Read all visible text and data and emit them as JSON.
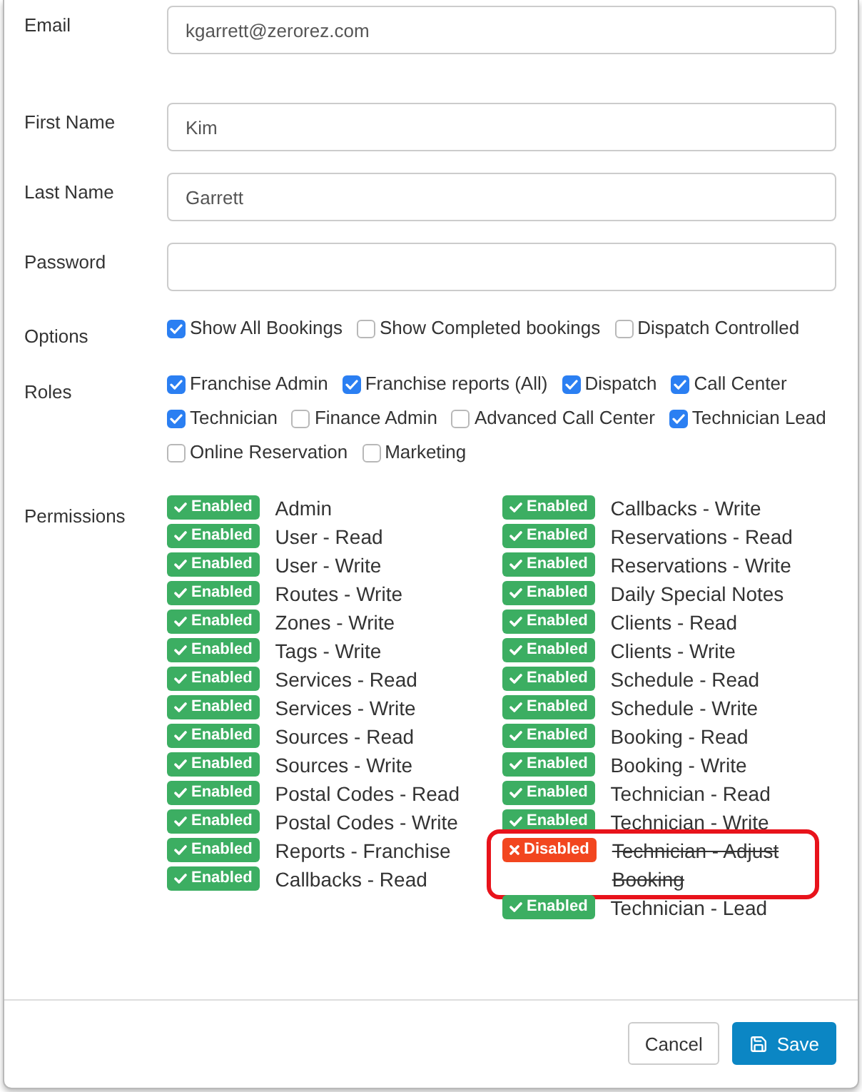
{
  "fields": [
    {
      "label": "Email",
      "value": "kgarrett@zerorez.com"
    },
    {
      "label": "First Name",
      "value": "Kim"
    },
    {
      "label": "Last Name",
      "value": "Garrett"
    },
    {
      "label": "Password"
    }
  ],
  "options": {
    "label": "Options",
    "items": [
      {
        "label": "Show All Bookings",
        "checked": true
      },
      {
        "label": "Show Completed bookings",
        "checked": false
      },
      {
        "label": "Dispatch Controlled",
        "checked": false
      }
    ]
  },
  "roles": {
    "label": "Roles",
    "items": [
      {
        "label": "Franchise Admin",
        "checked": true
      },
      {
        "label": "Franchise reports (All)",
        "checked": true
      },
      {
        "label": "Dispatch",
        "checked": true
      },
      {
        "label": "Call Center",
        "checked": true
      },
      {
        "label": "Technician",
        "checked": true
      },
      {
        "label": "Finance Admin",
        "checked": false
      },
      {
        "label": "Advanced Call Center",
        "checked": false
      },
      {
        "label": "Technician Lead",
        "checked": true
      },
      {
        "label": "Online Reservation",
        "checked": false
      },
      {
        "label": "Marketing",
        "checked": false
      }
    ]
  },
  "permissions": {
    "label": "Permissions",
    "columns": [
      [
        {
          "status": "Enabled",
          "enabled": true,
          "name": "Admin",
          "highlighted": false
        },
        {
          "status": "Enabled",
          "enabled": true,
          "name": "User - Read",
          "highlighted": false
        },
        {
          "status": "Enabled",
          "enabled": true,
          "name": "User - Write",
          "highlighted": false
        },
        {
          "status": "Enabled",
          "enabled": true,
          "name": "Routes - Write",
          "highlighted": false
        },
        {
          "status": "Enabled",
          "enabled": true,
          "name": "Zones - Write",
          "highlighted": false
        },
        {
          "status": "Enabled",
          "enabled": true,
          "name": "Tags - Write",
          "highlighted": false
        },
        {
          "status": "Enabled",
          "enabled": true,
          "name": "Services - Read",
          "highlighted": false
        },
        {
          "status": "Enabled",
          "enabled": true,
          "name": "Services - Write",
          "highlighted": false
        },
        {
          "status": "Enabled",
          "enabled": true,
          "name": "Sources - Read",
          "highlighted": false
        },
        {
          "status": "Enabled",
          "enabled": true,
          "name": "Sources - Write",
          "highlighted": false
        },
        {
          "status": "Enabled",
          "enabled": true,
          "name": "Postal Codes - Read",
          "highlighted": false
        },
        {
          "status": "Enabled",
          "enabled": true,
          "name": "Postal Codes - Write",
          "highlighted": false
        },
        {
          "status": "Enabled",
          "enabled": true,
          "name": "Reports - Franchise",
          "highlighted": false
        },
        {
          "status": "Enabled",
          "enabled": true,
          "name": "Callbacks - Read",
          "highlighted": false
        }
      ],
      [
        {
          "status": "Enabled",
          "enabled": true,
          "name": "Callbacks - Write",
          "highlighted": false
        },
        {
          "status": "Enabled",
          "enabled": true,
          "name": "Reservations - Read",
          "highlighted": false
        },
        {
          "status": "Enabled",
          "enabled": true,
          "name": "Reservations - Write",
          "highlighted": false
        },
        {
          "status": "Enabled",
          "enabled": true,
          "name": "Daily Special Notes",
          "highlighted": false
        },
        {
          "status": "Enabled",
          "enabled": true,
          "name": "Clients - Read",
          "highlighted": false
        },
        {
          "status": "Enabled",
          "enabled": true,
          "name": "Clients - Write",
          "highlighted": false
        },
        {
          "status": "Enabled",
          "enabled": true,
          "name": "Schedule - Read",
          "highlighted": false
        },
        {
          "status": "Enabled",
          "enabled": true,
          "name": "Schedule - Write",
          "highlighted": false
        },
        {
          "status": "Enabled",
          "enabled": true,
          "name": "Booking - Read",
          "highlighted": false
        },
        {
          "status": "Enabled",
          "enabled": true,
          "name": "Booking - Write",
          "highlighted": false
        },
        {
          "status": "Enabled",
          "enabled": true,
          "name": "Technician - Read",
          "highlighted": false
        },
        {
          "status": "Enabled",
          "enabled": true,
          "name": "Technician - Write",
          "highlighted": false
        },
        {
          "status": "Disabled",
          "enabled": false,
          "name": "Technician - Adjust Booking",
          "highlighted": true
        },
        {
          "status": "Enabled",
          "enabled": true,
          "name": "Technician - Lead",
          "highlighted": false
        }
      ]
    ]
  },
  "footer": {
    "buttons": [
      {
        "label": "Cancel",
        "kind": "default"
      },
      {
        "label": "Save",
        "kind": "primary"
      }
    ]
  }
}
